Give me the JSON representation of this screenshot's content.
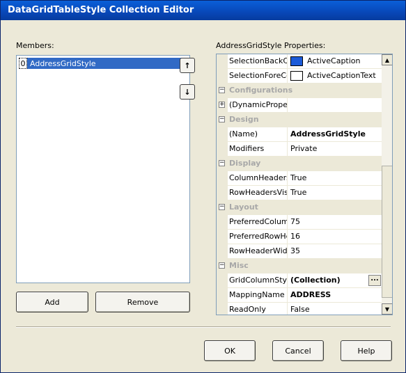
{
  "window": {
    "title": "DataGridTableStyle Collection Editor"
  },
  "members": {
    "label": "Members:",
    "items": [
      {
        "index": "0",
        "name": "AddressGridStyle"
      }
    ],
    "up_icon": "↑",
    "down_icon": "↓",
    "add_label": "Add",
    "remove_label": "Remove"
  },
  "properties": {
    "label": "AddressGridStyle Properties:",
    "rows": [
      {
        "type": "prop",
        "name": "SelectionBackColor",
        "value": "ActiveCaption",
        "swatch": "#1c5bd8"
      },
      {
        "type": "prop",
        "name": "SelectionForeColor",
        "value": "ActiveCaptionText",
        "swatch": "#ffffff"
      },
      {
        "type": "cat",
        "name": "Configurations"
      },
      {
        "type": "expand",
        "name": "(DynamicProperties)",
        "value": ""
      },
      {
        "type": "cat",
        "name": "Design"
      },
      {
        "type": "prop",
        "name": "(Name)",
        "value": "AddressGridStyle",
        "bold": true
      },
      {
        "type": "prop",
        "name": "Modifiers",
        "value": "Private"
      },
      {
        "type": "cat",
        "name": "Display"
      },
      {
        "type": "prop",
        "name": "ColumnHeadersVisible",
        "value": "True"
      },
      {
        "type": "prop",
        "name": "RowHeadersVisible",
        "value": "True"
      },
      {
        "type": "cat",
        "name": "Layout"
      },
      {
        "type": "prop",
        "name": "PreferredColumnWidth",
        "value": "75"
      },
      {
        "type": "prop",
        "name": "PreferredRowHeight",
        "value": "16"
      },
      {
        "type": "prop",
        "name": "RowHeaderWidth",
        "value": "35"
      },
      {
        "type": "cat",
        "name": "Misc"
      },
      {
        "type": "prop",
        "name": "GridColumnStyles",
        "value": "(Collection)",
        "bold": true,
        "ellipsis": true
      },
      {
        "type": "prop",
        "name": "MappingName",
        "value": "ADDRESS",
        "bold": true
      },
      {
        "type": "prop",
        "name": "ReadOnly",
        "value": "False"
      }
    ]
  },
  "footer": {
    "ok_label": "OK",
    "cancel_label": "Cancel",
    "help_label": "Help"
  }
}
